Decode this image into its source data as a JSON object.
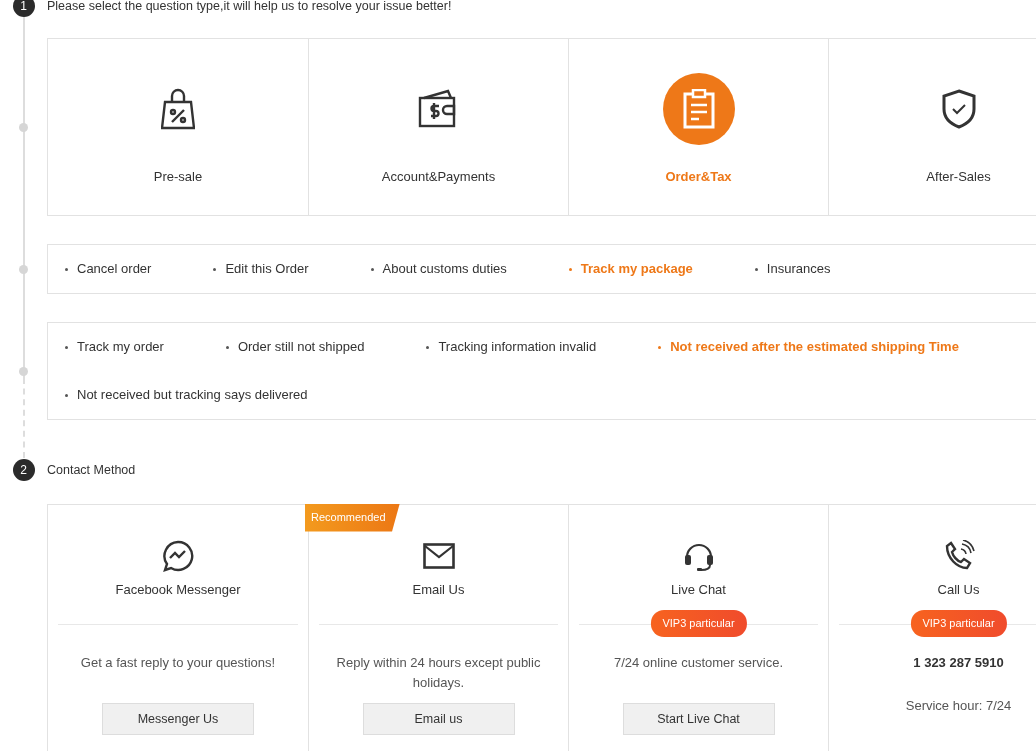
{
  "step1": {
    "number": "1",
    "title": "Please select the question type,it will help us to resolve your issue better!"
  },
  "question_types": [
    {
      "label": "Pre-sale",
      "selected": false
    },
    {
      "label": "Account&Payments",
      "selected": false
    },
    {
      "label": "Order&Tax",
      "selected": true
    },
    {
      "label": "After-Sales",
      "selected": false
    }
  ],
  "subtypes": [
    {
      "label": "Cancel order",
      "selected": false
    },
    {
      "label": "Edit this Order",
      "selected": false
    },
    {
      "label": "About customs duties",
      "selected": false
    },
    {
      "label": "Track my package",
      "selected": true
    },
    {
      "label": "Insurances",
      "selected": false
    }
  ],
  "issues": [
    {
      "label": "Track my order",
      "selected": false
    },
    {
      "label": "Order still not shipped",
      "selected": false
    },
    {
      "label": "Tracking information invalid",
      "selected": false
    },
    {
      "label": "Not received after the estimated shipping Time",
      "selected": true
    },
    {
      "label": "Not received but tracking says delivered",
      "selected": false
    }
  ],
  "step2": {
    "number": "2",
    "title": "Contact Method"
  },
  "contact_methods": [
    {
      "title": "Facebook Messenger",
      "description": "Get a fast reply to your questions!",
      "button": "Messenger Us"
    },
    {
      "ribbon": "Recommended",
      "title": "Email Us",
      "description": "Reply within 24 hours except public holidays.",
      "button": "Email us"
    },
    {
      "title": "Live Chat",
      "badge": "VIP3 particular",
      "description": "7/24 online customer service.",
      "button": "Start Live Chat"
    },
    {
      "title": "Call Us",
      "badge": "VIP3 particular",
      "phone": "1 323 287 5910",
      "hours": "Service hour: 7/24"
    }
  ]
}
